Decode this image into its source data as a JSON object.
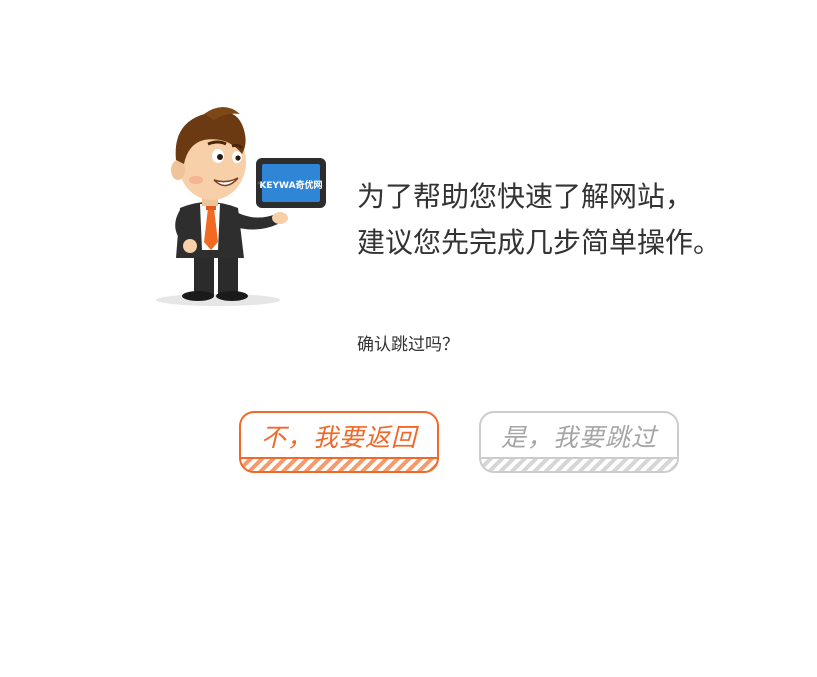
{
  "illustration": {
    "tablet_brand": "KEYWA奇优网"
  },
  "headline": {
    "line1": "为了帮助您快速了解网站，",
    "line2": "建议您先完成几步简单操作。"
  },
  "question": "确认跳过吗？",
  "buttons": {
    "back_label": "不，我要返回",
    "skip_label": "是，我要跳过"
  },
  "colors": {
    "back_accent": "#f0692a",
    "skip_accent": "#cccccc",
    "text": "#333333"
  }
}
